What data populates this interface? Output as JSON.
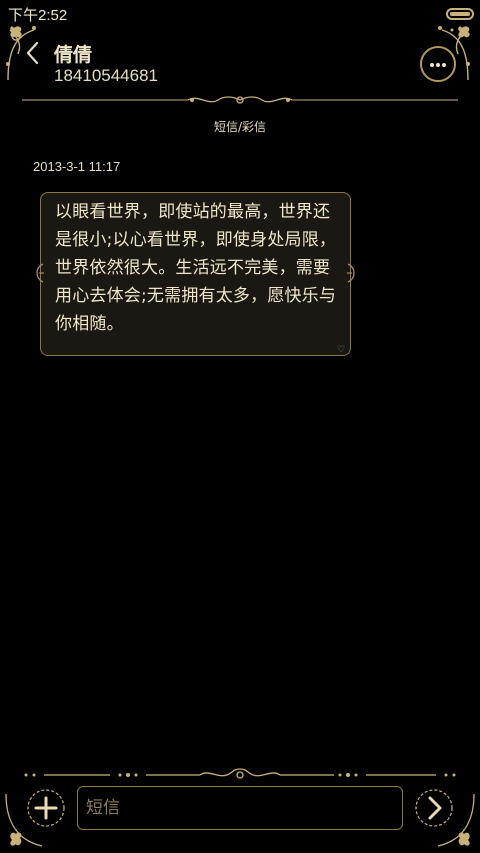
{
  "status_bar": {
    "time": "下午2:52"
  },
  "header": {
    "contact_name": "倩倩",
    "contact_number": "18410544681"
  },
  "conversation": {
    "type_label": "短信/彩信",
    "messages": [
      {
        "timestamp": "2013-3-1 11:17",
        "text": "以眼看世界，即使站的最高，世界还是很小;以心看世界，即使身处局限，世界依然很大。生活远不完美，需要用心去体会;无需拥有太多，愿快乐与你相随。"
      }
    ]
  },
  "composer": {
    "placeholder": "短信"
  },
  "colors": {
    "background": "#000000",
    "gold": "#c9b27a",
    "text": "#f0e6c8"
  }
}
